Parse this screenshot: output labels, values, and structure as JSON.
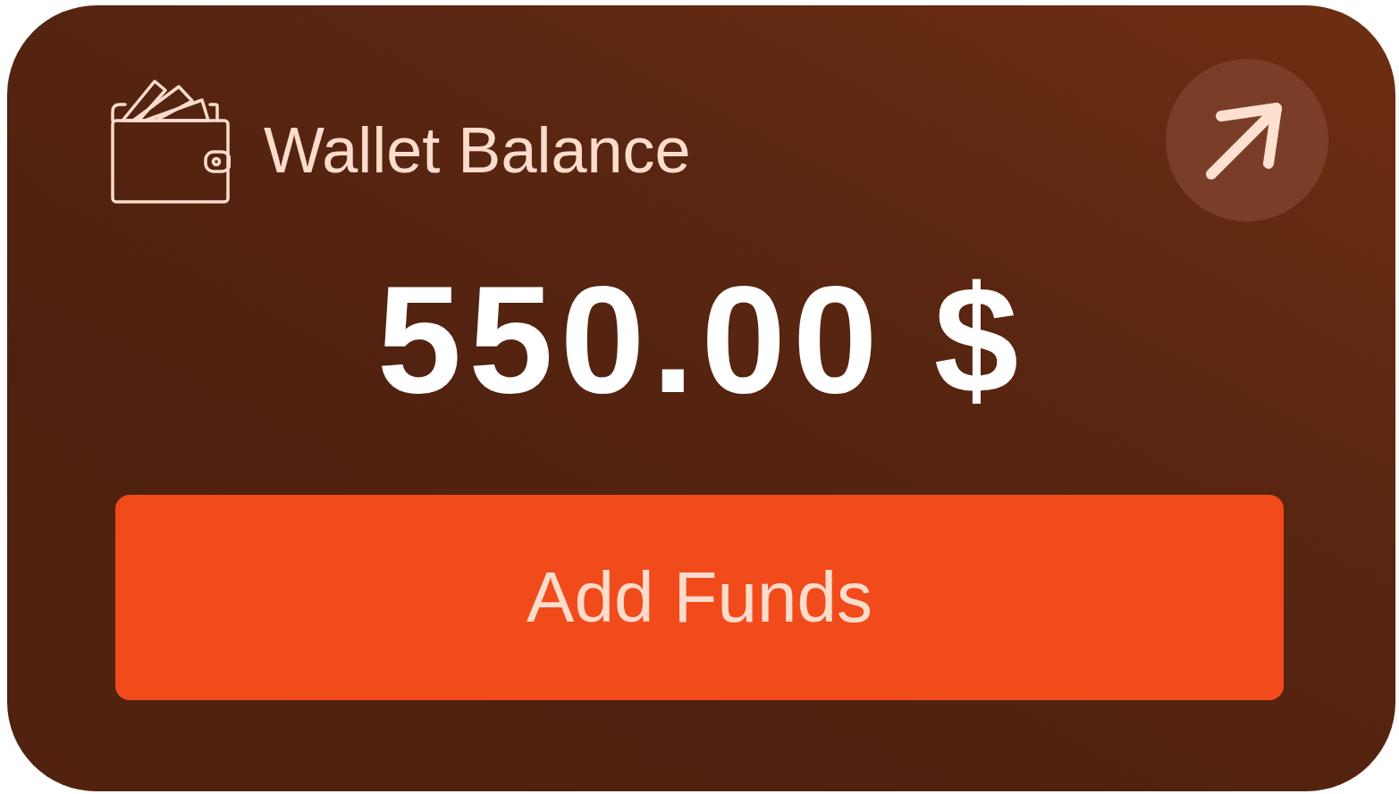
{
  "card": {
    "title": "Wallet Balance",
    "amount": "550.00 $",
    "action_button": "Add Funds"
  }
}
